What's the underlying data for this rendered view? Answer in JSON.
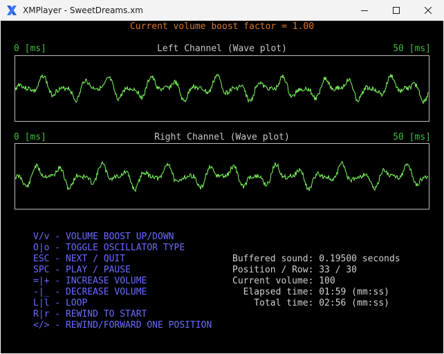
{
  "window": {
    "title": "XMPlayer - SweetDreams.xm",
    "icon": "x-app-icon"
  },
  "header": {
    "boost_text": "Current volume boost factor = 1.00"
  },
  "left_channel": {
    "title": "Left Channel (Wave plot)",
    "start_label": "0 [ms]",
    "end_label": "50 [ms]"
  },
  "right_channel": {
    "title": "Right Channel (Wave plot)",
    "start_label": "0 [ms]",
    "end_label": "50 [ms]"
  },
  "keys": [
    "V/v - VOLUME BOOST UP/DOWN",
    "O|o - TOGGLE OSCILLATOR TYPE",
    "ESC - NEXT / QUIT",
    "SPC - PLAY / PAUSE",
    "=|+ - INCREASE VOLUME",
    "-|_ - DECREASE VOLUME",
    "L|l - LOOP",
    "R|r - REWIND TO START",
    "</> - REWIND/FORWARD ONE POSITION"
  ],
  "stats": [
    "Buffered sound: 0.19500 seconds",
    "Position / Row: 33 / 30",
    "Current volume: 100",
    "  Elapsed time: 01:59 (mm:ss)",
    "    Total time: 02:56 (mm:ss)"
  ],
  "colors": {
    "wave": "#7fff5f",
    "boost": "#d9772a",
    "keys": "#6b6bff",
    "ms_labels": "#3fbf3f"
  }
}
